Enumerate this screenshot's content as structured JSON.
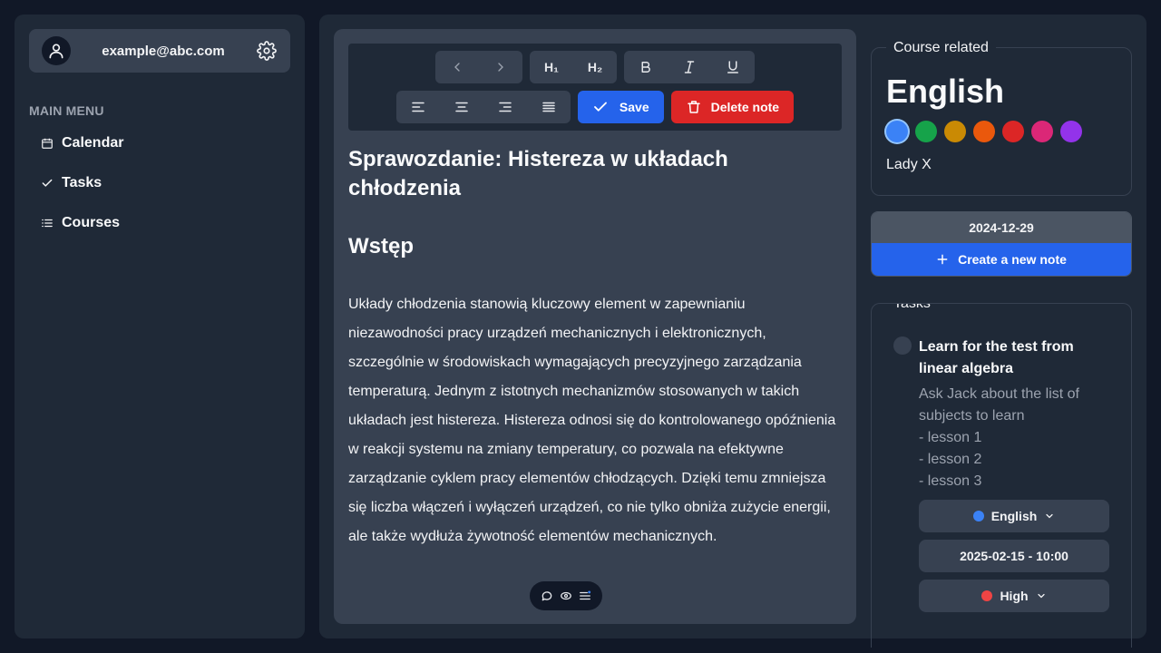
{
  "user": {
    "email": "example@abc.com"
  },
  "menu": {
    "title": "MAIN MENU",
    "items": [
      {
        "label": "Calendar",
        "icon": "calendar-icon"
      },
      {
        "label": "Tasks",
        "icon": "check-icon"
      },
      {
        "label": "Courses",
        "icon": "list-icon"
      }
    ]
  },
  "toolbar": {
    "h1": "H₁",
    "h2": "H₂",
    "save_label": "Save",
    "delete_label": "Delete note"
  },
  "note": {
    "title": "Sprawozdanie: Histereza w układach chłodzenia",
    "heading": "Wstęp",
    "body": "Układy chłodzenia stanowią kluczowy element w zapewnianiu niezawodności pracy urządzeń mechanicznych i elektronicznych, szczególnie w środowiskach wymagających precyzyjnego zarządzania temperaturą. Jednym z istotnych mechanizmów stosowanych w takich układach jest histereza. Histereza odnosi się do kontrolowanego opóźnienia w reakcji systemu na zmiany temperatury, co pozwala na efektywne zarządzanie cyklem pracy elementów chłodzących. Dzięki temu zmniejsza się liczba włączeń i wyłączeń urządzeń, co nie tylko obniża zużycie energii, ale także wydłuża żywotność elementów mechanicznych."
  },
  "course": {
    "legend": "Course related",
    "name": "English",
    "teacher": "Lady X",
    "colors": [
      "#3b82f6",
      "#16a34a",
      "#ca8a04",
      "#ea580c",
      "#dc2626",
      "#db2777",
      "#9333ea"
    ],
    "selected_color": "#3b82f6"
  },
  "notes": {
    "date": "2024-12-29",
    "create_label": "Create a new note"
  },
  "tasks": {
    "legend": "Tasks",
    "items": [
      {
        "title": "Learn for the test from linear algebra",
        "desc_lines": [
          "Ask Jack about the list of",
          "subjects to learn",
          "- lesson 1",
          "- lesson 2",
          "- lesson 3"
        ],
        "course": "English",
        "course_color": "#3b82f6",
        "due": "2025-02-15 - 10:00",
        "priority": "High",
        "priority_color": "#ef4444"
      }
    ]
  }
}
